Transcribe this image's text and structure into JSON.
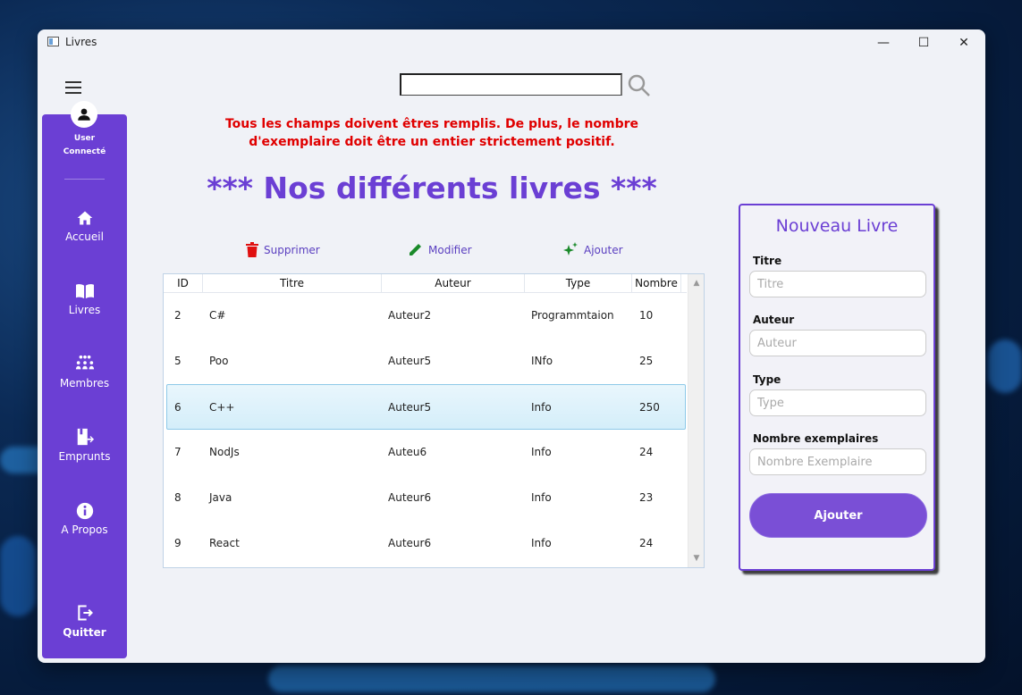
{
  "window": {
    "title": "Livres",
    "minimize": "—",
    "maximize": "☐",
    "close": "✕"
  },
  "sidebar": {
    "user_name": "User",
    "user_status": "Connecté",
    "items": [
      {
        "label": "Accueil",
        "icon": "home-icon"
      },
      {
        "label": "Livres",
        "icon": "book-icon"
      },
      {
        "label": "Membres",
        "icon": "members-icon"
      },
      {
        "label": "Emprunts",
        "icon": "loan-icon"
      },
      {
        "label": "A Propos",
        "icon": "info-icon"
      }
    ],
    "quit_label": "Quitter"
  },
  "search": {
    "value": "",
    "placeholder": ""
  },
  "error_message": "Tous les champs doivent êtres remplis. De plus, le nombre d'exemplaire doit être un entier strictement positif.",
  "page_title": "*** Nos différents livres ***",
  "actions": {
    "delete": "Supprimer",
    "edit": "Modifier",
    "add": "Ajouter"
  },
  "colors": {
    "accent": "#6b3fd4",
    "error": "#e00000",
    "delete_icon": "#e01010",
    "edit_icon": "#1a8a2a"
  },
  "table": {
    "columns": [
      "ID",
      "Titre",
      "Auteur",
      "Type",
      "Nombre"
    ],
    "rows": [
      [
        "2",
        "C#",
        "Auteur2",
        "Programmtaion",
        "10"
      ],
      [
        "5",
        "Poo",
        "Auteur5",
        "INfo",
        "25"
      ],
      [
        "6",
        "C++",
        "Auteur5",
        "Info",
        "250"
      ],
      [
        "7",
        "NodJs",
        "Auteu6",
        "Info",
        "24"
      ],
      [
        "8",
        "Java",
        "Auteur6",
        "Info",
        "23"
      ],
      [
        "9",
        "React",
        "Auteur6",
        "Info",
        "24"
      ]
    ],
    "selected_row": 2
  },
  "form": {
    "title": "Nouveau Livre",
    "fields": [
      {
        "label": "Titre",
        "placeholder": "Titre",
        "value": ""
      },
      {
        "label": "Auteur",
        "placeholder": "Auteur",
        "value": ""
      },
      {
        "label": "Type",
        "placeholder": "Type",
        "value": ""
      },
      {
        "label": "Nombre exemplaires",
        "placeholder": "Nombre Exemplaire",
        "value": ""
      }
    ],
    "submit_label": "Ajouter"
  }
}
